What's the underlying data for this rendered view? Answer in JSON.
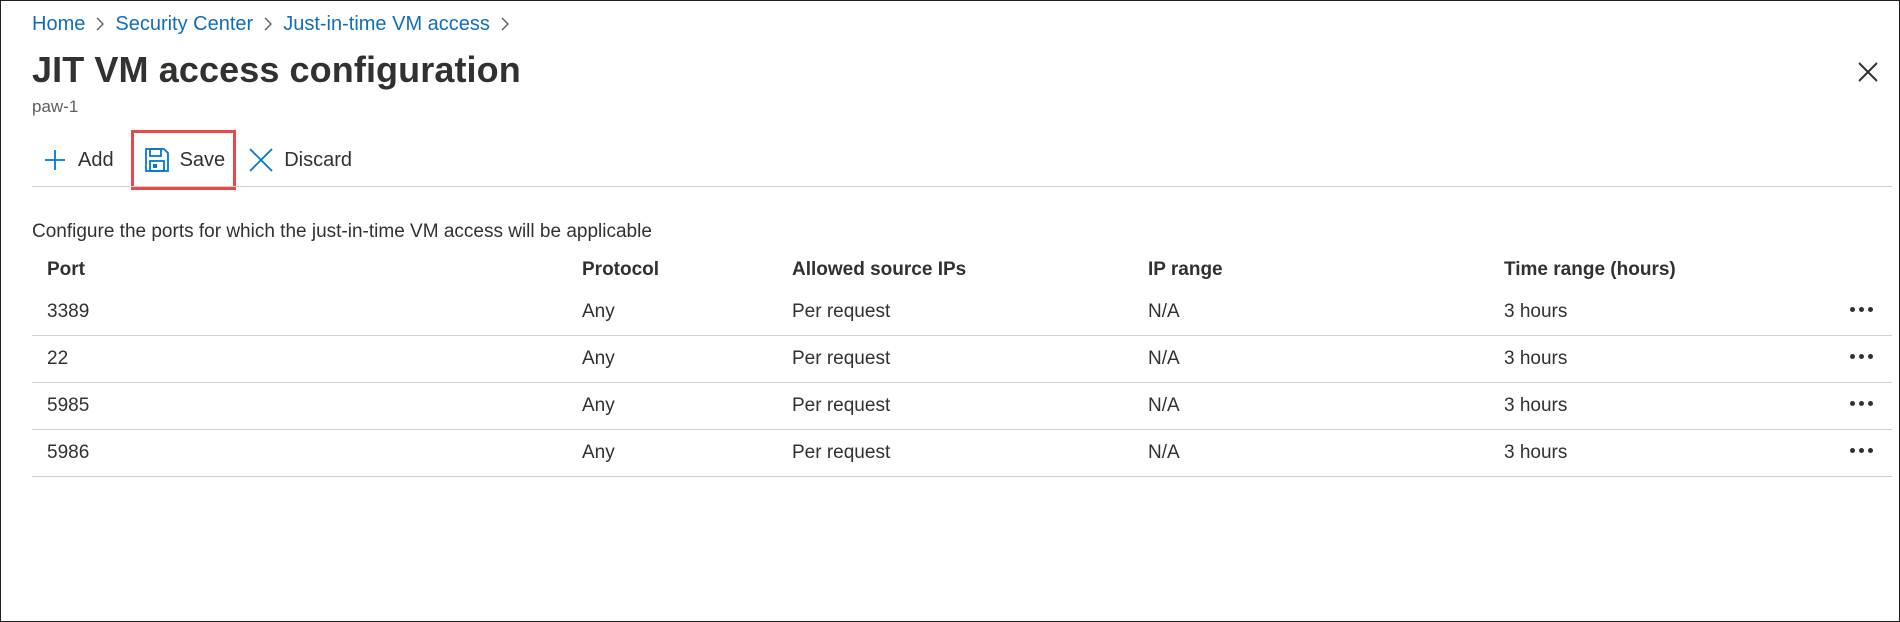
{
  "breadcrumb": {
    "items": [
      "Home",
      "Security Center",
      "Just-in-time VM access"
    ]
  },
  "page": {
    "title": "JIT VM access configuration",
    "subtitle": "paw-1"
  },
  "toolbar": {
    "add_label": "Add",
    "save_label": "Save",
    "discard_label": "Discard"
  },
  "description": "Configure the ports for which the just-in-time VM access will be applicable",
  "table": {
    "columns": [
      "Port",
      "Protocol",
      "Allowed source IPs",
      "IP range",
      "Time range (hours)"
    ],
    "rows": [
      [
        "3389",
        "Any",
        "Per request",
        "N/A",
        "3 hours"
      ],
      [
        "22",
        "Any",
        "Per request",
        "N/A",
        "3 hours"
      ],
      [
        "5985",
        "Any",
        "Per request",
        "N/A",
        "3 hours"
      ],
      [
        "5986",
        "Any",
        "Per request",
        "N/A",
        "3 hours"
      ]
    ]
  },
  "icons": {
    "add": "plus-icon",
    "save": "save-icon",
    "discard": "discard-icon",
    "close": "close-icon",
    "more": "more-options-icon",
    "breadcrumb_separator": "chevron-right-icon"
  },
  "colors": {
    "link": "#106ebe",
    "accent_icon": "#0078d4",
    "highlight_border": "#e8474c",
    "text": "#323130",
    "divider": "#d2d0ce"
  }
}
